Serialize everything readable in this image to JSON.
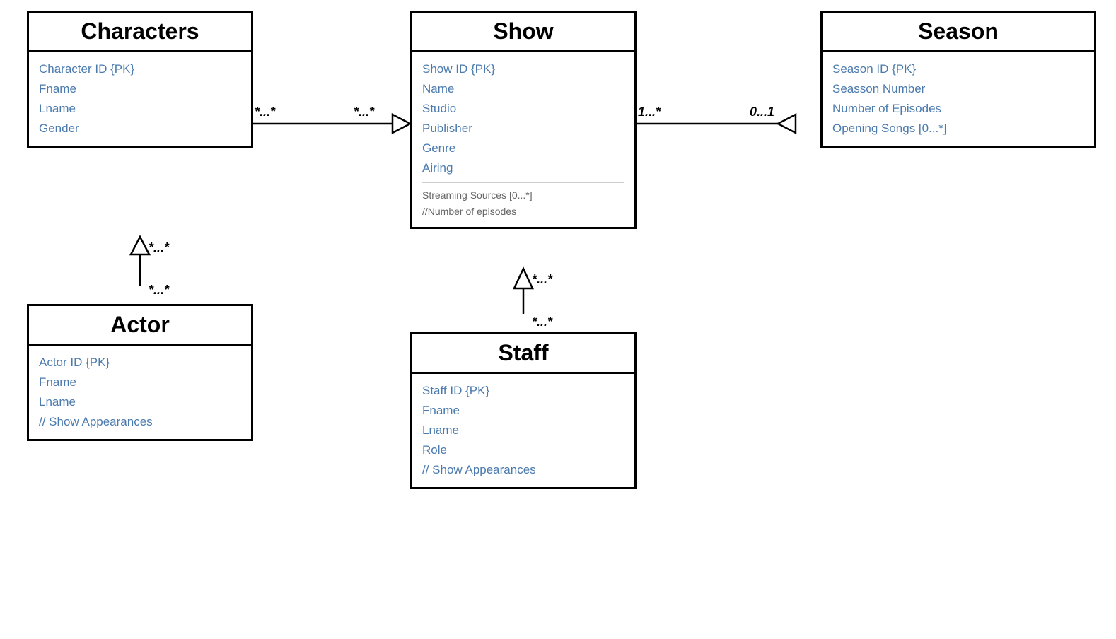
{
  "characters": {
    "title": "Characters",
    "fields": [
      "Character ID  {PK}",
      "Fname",
      "Lname",
      "Gender"
    ]
  },
  "show": {
    "title": "Show",
    "fields": [
      "Show ID  {PK}",
      "Name",
      "Studio",
      "Publisher",
      "Genre",
      "Airing"
    ],
    "derived_fields": [
      "Streaming Sources  [0...*]",
      "//Number of episodes"
    ]
  },
  "season": {
    "title": "Season",
    "fields": [
      "Season ID  {PK}",
      "Seasson Number",
      "Number of Episodes",
      "Opening Songs  [0...*]"
    ]
  },
  "actor": {
    "title": "Actor",
    "fields": [
      "Actor ID  {PK}",
      "Fname",
      "Lname",
      "//  Show Appearances"
    ]
  },
  "staff": {
    "title": "Staff",
    "fields": [
      "Staff ID  {PK}",
      "Fname",
      "Lname",
      "Role",
      "//  Show Appearances"
    ]
  },
  "multiplicities": {
    "char_show_left": "*...*",
    "char_show_right": "*...*",
    "show_season_left": "1...*",
    "show_season_right": "0...1",
    "actor_char_top": "*...*",
    "actor_char_bottom": "*...*",
    "staff_show_top": "*...*",
    "staff_show_bottom": "*...*"
  }
}
